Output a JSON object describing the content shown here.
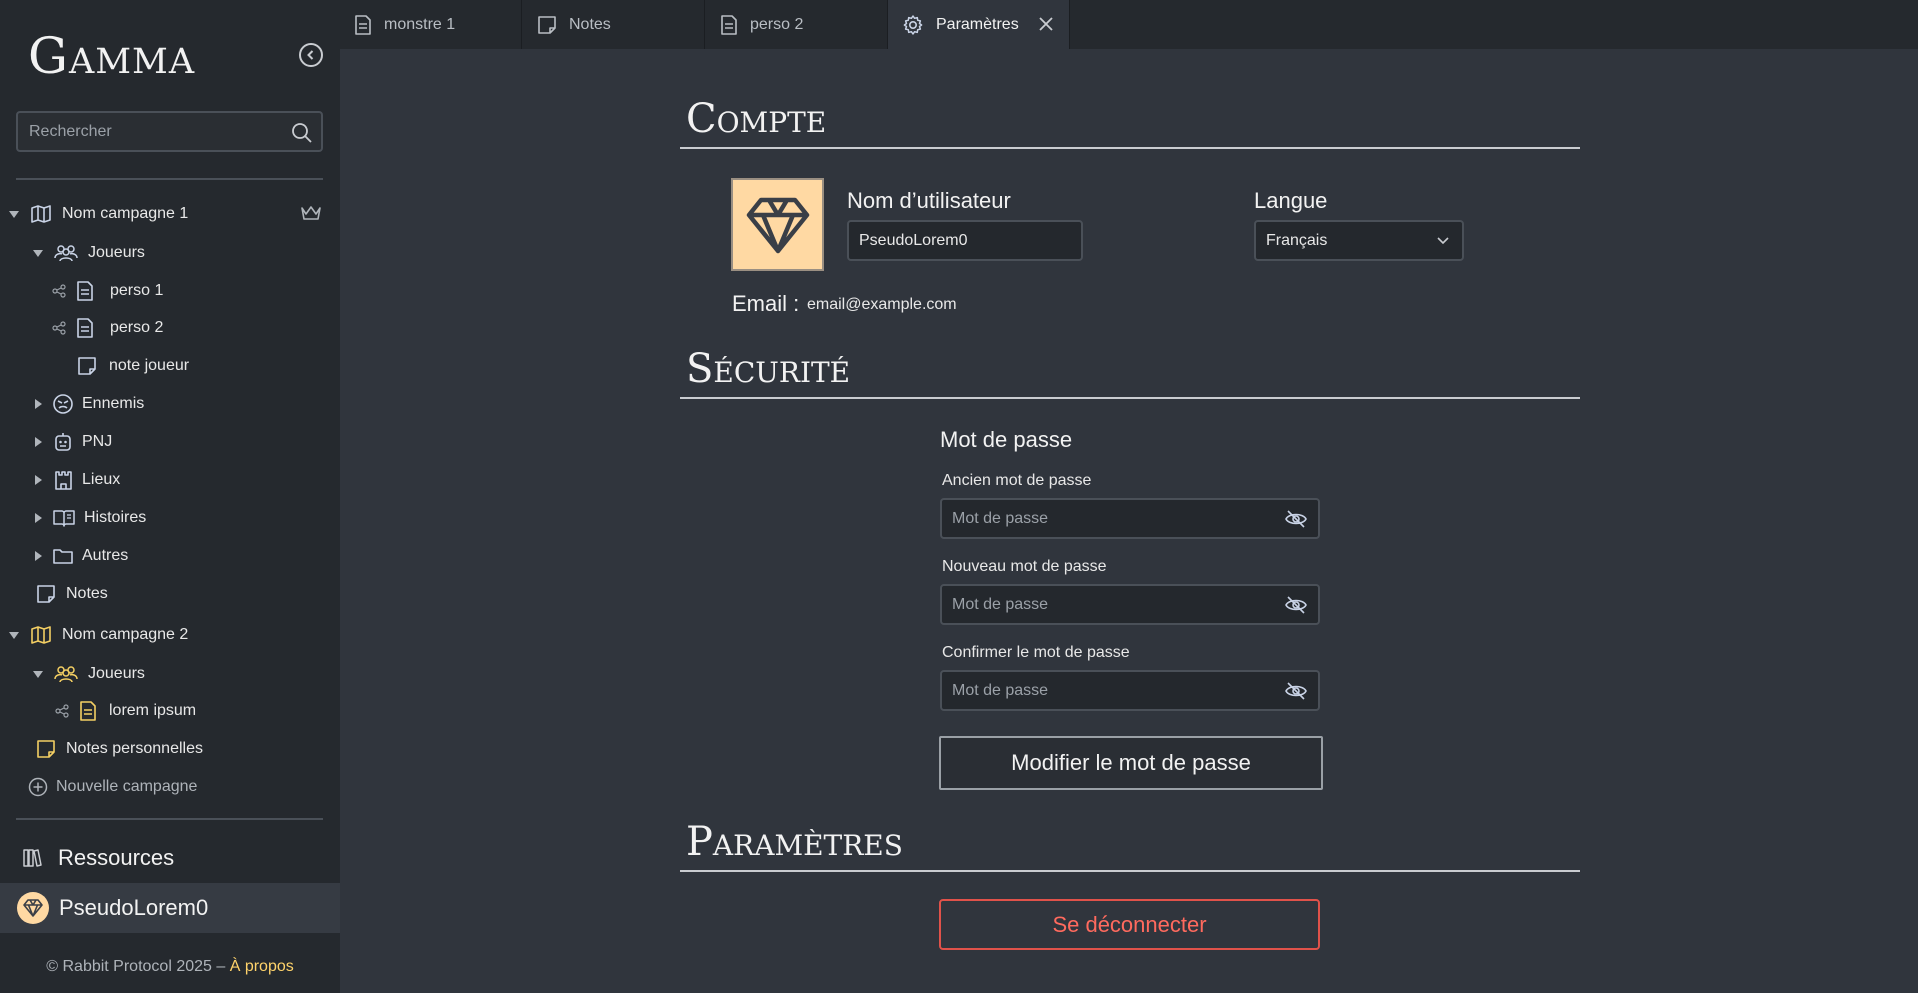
{
  "app": {
    "logo": "Gamma"
  },
  "search": {
    "placeholder": "Rechercher"
  },
  "tree": {
    "campaign1": {
      "label": "Nom campagne 1"
    },
    "c1_players": {
      "label": "Joueurs"
    },
    "c1_perso1": {
      "label": "perso 1"
    },
    "c1_perso2": {
      "label": "perso 2"
    },
    "c1_note": {
      "label": "note joueur"
    },
    "c1_enemies": {
      "label": "Ennemis"
    },
    "c1_pnj": {
      "label": "PNJ"
    },
    "c1_places": {
      "label": "Lieux"
    },
    "c1_stories": {
      "label": "Histoires"
    },
    "c1_others": {
      "label": "Autres"
    },
    "c1_notes": {
      "label": "Notes"
    },
    "campaign2": {
      "label": "Nom campagne 2"
    },
    "c2_players": {
      "label": "Joueurs"
    },
    "c2_lorem": {
      "label": "lorem ipsum"
    },
    "c2_personal_notes": {
      "label": "Notes personnelles"
    },
    "new_campaign": {
      "label": "Nouvelle campagne"
    }
  },
  "sidebar_bottom": {
    "resources": "Ressources",
    "username": "PseudoLorem0",
    "footer_text": "© Rabbit Protocol 2025 – ",
    "footer_link": "À propos"
  },
  "tabs": [
    {
      "label": "monstre 1",
      "icon": "document-icon"
    },
    {
      "label": "Notes",
      "icon": "note-icon"
    },
    {
      "label": "perso 2",
      "icon": "document-icon"
    },
    {
      "label": "Paramètres",
      "icon": "gear-icon"
    }
  ],
  "account": {
    "title": "Compte",
    "username_label": "Nom d’utilisateur",
    "username_value": "PseudoLorem0",
    "language_label": "Langue",
    "language_value": "Français",
    "email_label": "Email :",
    "email_value": "email@example.com"
  },
  "security": {
    "title": "Sécurité",
    "password_title": "Mot de passe",
    "old_label": "Ancien mot de passe",
    "new_label": "Nouveau mot de passe",
    "confirm_label": "Confirmer le mot de passe",
    "placeholder": "Mot de passe",
    "change_button": "Modifier le mot de passe"
  },
  "settings": {
    "title": "Paramètres",
    "logout_button": "Se déconnecter"
  },
  "colors": {
    "accent": "#ffd36b",
    "avatar_bg": "#ffd9a3",
    "danger": "#e0524a",
    "campaign2_icons": "#f4cf63"
  }
}
